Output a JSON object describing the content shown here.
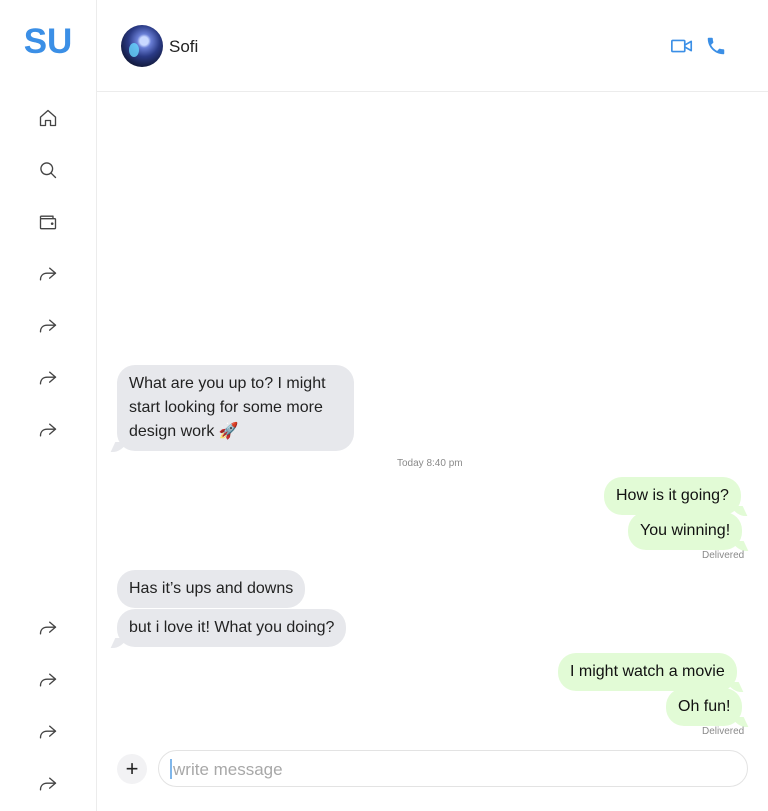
{
  "app": {
    "logo": "SU",
    "accent_color": "#3b8fe6"
  },
  "sidebar": {
    "items": [
      {
        "icon": "home-icon"
      },
      {
        "icon": "search-icon"
      },
      {
        "icon": "wallet-icon"
      },
      {
        "icon": "share-icon"
      },
      {
        "icon": "share-icon"
      },
      {
        "icon": "share-icon"
      },
      {
        "icon": "share-icon"
      },
      {
        "icon": "share-icon"
      },
      {
        "icon": "share-icon"
      },
      {
        "icon": "share-icon"
      },
      {
        "icon": "share-icon"
      }
    ]
  },
  "header": {
    "contact_name": "Sofi",
    "actions": [
      {
        "icon": "video-call-icon"
      },
      {
        "icon": "phone-icon"
      }
    ]
  },
  "chat": {
    "messages": [
      {
        "direction": "incoming",
        "text": "What are you up to? I might\nstart looking for some more\ndesign work 🚀"
      },
      {
        "direction": "outgoing",
        "text": "How is it going?"
      },
      {
        "direction": "outgoing",
        "text": "You winning!"
      },
      {
        "direction": "incoming",
        "text": "Has it’s ups and downs"
      },
      {
        "direction": "incoming",
        "text": "but i love it! What you doing?"
      },
      {
        "direction": "outgoing",
        "text": "I might watch a movie"
      },
      {
        "direction": "outgoing",
        "text": "Oh fun!"
      }
    ],
    "timestamp": "Today 8:40 pm",
    "status_1": "Delivered",
    "status_2": "Delivered",
    "incoming_color": "#e7e8ec",
    "outgoing_color": "#e2fbd6"
  },
  "composer": {
    "placeholder": "write message",
    "value": "",
    "add_label": "+"
  }
}
